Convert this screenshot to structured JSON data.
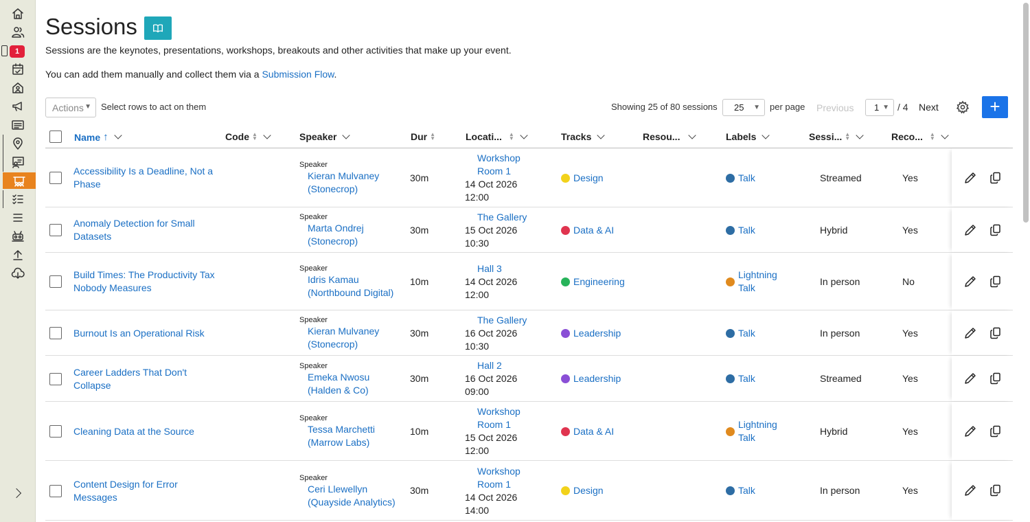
{
  "sidebar": {
    "badge": "1",
    "items": [
      {
        "icon": "home-icon"
      },
      {
        "icon": "users-icon"
      },
      {
        "icon": "calendar-icon"
      },
      {
        "icon": "venue-icon"
      },
      {
        "icon": "megaphone-icon"
      },
      {
        "icon": "list-icon"
      },
      {
        "icon": "location-pin-icon"
      },
      {
        "icon": "speaker-icon"
      },
      {
        "icon": "sessions-icon"
      },
      {
        "icon": "checklist-icon"
      },
      {
        "icon": "menu-lines-icon"
      },
      {
        "icon": "broadcast-icon"
      },
      {
        "icon": "upload-icon"
      },
      {
        "icon": "cloud-download-icon"
      }
    ]
  },
  "header": {
    "title": "Sessions",
    "description": "Sessions are the keynotes, presentations, workshops, breakouts and other activities that make up your event.",
    "add_text_prefix": "You can add them manually and collect them via a ",
    "add_text_link": "Submission Flow",
    "add_text_suffix": "."
  },
  "toolbar": {
    "actions_label": "Actions",
    "select_hint": "Select rows to act on them",
    "showing": "Showing 25 of 80 sessions",
    "per_page_value": "25",
    "per_page_label": "per page",
    "previous": "Previous",
    "page_value": "1",
    "page_total": "/ 4",
    "next": "Next",
    "add_label": "+"
  },
  "table": {
    "columns": {
      "name": "Name",
      "code": "Code",
      "speaker": "Speaker",
      "dur": "Dur",
      "location": "Locati...",
      "tracks": "Tracks",
      "resources": "Resou...",
      "labels": "Labels",
      "session": "Sessi...",
      "recorded": "Reco..."
    },
    "rows": [
      {
        "name": "Accessibility Is a Deadline, Not a Phase",
        "speaker_role": "Speaker",
        "speaker": "Kieran Mulvaney (Stonecrop)",
        "dur": "30m",
        "location": "Workshop Room 1",
        "date": "14 Oct 2026",
        "time": "12:00",
        "track": "Design",
        "track_color": "#f2d21b",
        "label": "Talk",
        "label_color": "#2e6da4",
        "session": "Streamed",
        "recorded": "Yes"
      },
      {
        "name": "Anomaly Detection for Small Datasets",
        "speaker_role": "Speaker",
        "speaker": "Marta Ondrej (Stonecrop)",
        "dur": "30m",
        "location": "The Gallery",
        "date": "15 Oct 2026",
        "time": "10:30",
        "track": "Data & AI",
        "track_color": "#e0344f",
        "label": "Talk",
        "label_color": "#2e6da4",
        "session": "Hybrid",
        "recorded": "Yes"
      },
      {
        "name": "Build Times: The Productivity Tax Nobody Measures",
        "speaker_role": "Speaker",
        "speaker": "Idris Kamau (Northbound Digital)",
        "dur": "10m",
        "location": "Hall 3",
        "date": "14 Oct 2026",
        "time": "12:00",
        "track": "Engineering",
        "track_color": "#27b35a",
        "label": "Lightning Talk",
        "label_color": "#e08a1e",
        "session": "In person",
        "recorded": "No"
      },
      {
        "name": "Burnout Is an Operational Risk",
        "speaker_role": "Speaker",
        "speaker": "Kieran Mulvaney (Stonecrop)",
        "dur": "30m",
        "location": "The Gallery",
        "date": "16 Oct 2026",
        "time": "10:30",
        "track": "Leadership",
        "track_color": "#8a4fd6",
        "label": "Talk",
        "label_color": "#2e6da4",
        "session": "In person",
        "recorded": "Yes"
      },
      {
        "name": "Career Ladders That Don't Collapse",
        "speaker_role": "Speaker",
        "speaker": "Emeka Nwosu (Halden & Co)",
        "dur": "30m",
        "location": "Hall 2",
        "date": "16 Oct 2026",
        "time": "09:00",
        "track": "Leadership",
        "track_color": "#8a4fd6",
        "label": "Talk",
        "label_color": "#2e6da4",
        "session": "Streamed",
        "recorded": "Yes"
      },
      {
        "name": "Cleaning Data at the Source",
        "speaker_role": "Speaker",
        "speaker": "Tessa Marchetti (Marrow Labs)",
        "dur": "10m",
        "location": "Workshop Room 1",
        "date": "15 Oct 2026",
        "time": "12:00",
        "track": "Data & AI",
        "track_color": "#e0344f",
        "label": "Lightning Talk",
        "label_color": "#e08a1e",
        "session": "Hybrid",
        "recorded": "Yes"
      },
      {
        "name": "Content Design for Error Messages",
        "speaker_role": "Speaker",
        "speaker": "Ceri Llewellyn (Quayside Analytics)",
        "dur": "30m",
        "location": "Workshop Room 1",
        "date": "14 Oct 2026",
        "time": "14:00",
        "track": "Design",
        "track_color": "#f2d21b",
        "label": "Talk",
        "label_color": "#2e6da4",
        "session": "In person",
        "recorded": "Yes"
      }
    ]
  }
}
